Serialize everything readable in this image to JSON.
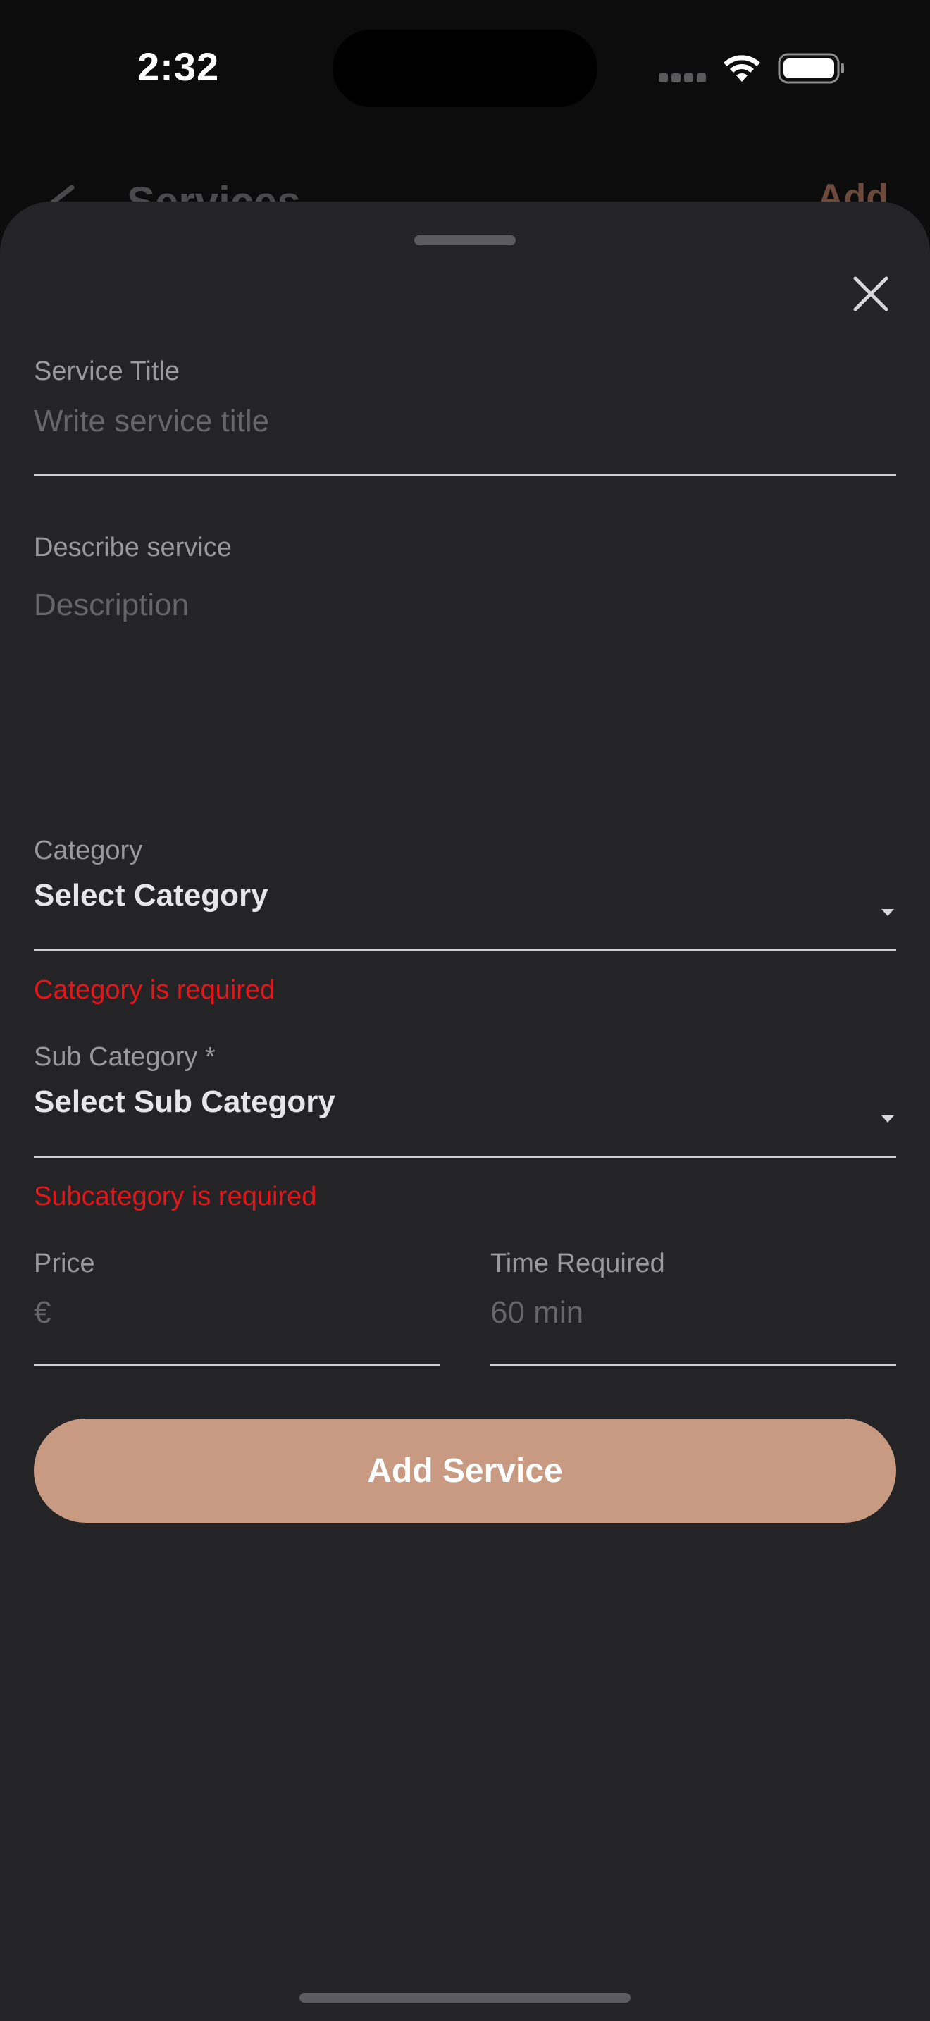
{
  "status_bar": {
    "time": "2:32"
  },
  "background_header": {
    "title": "Services",
    "action_label": "Add"
  },
  "form": {
    "service_title": {
      "label": "Service Title",
      "placeholder": "Write service title",
      "value": ""
    },
    "description": {
      "label": "Describe service",
      "placeholder": "Description",
      "value": ""
    },
    "category": {
      "label": "Category",
      "selected": "Select Category",
      "error": "Category is required"
    },
    "sub_category": {
      "label": "Sub Category *",
      "selected": "Select Sub Category",
      "error": "Subcategory is required"
    },
    "price": {
      "label": "Price",
      "placeholder": "€",
      "value": ""
    },
    "time_required": {
      "label": "Time Required",
      "placeholder": "60 min",
      "value": ""
    },
    "submit_label": "Add Service"
  },
  "colors": {
    "accent": "#c99a82",
    "error": "#e4161a",
    "sheet_background": "#242426"
  },
  "icons": {
    "close": "close-icon",
    "caret": "chevron-down-icon",
    "back": "chevron-left-icon"
  }
}
